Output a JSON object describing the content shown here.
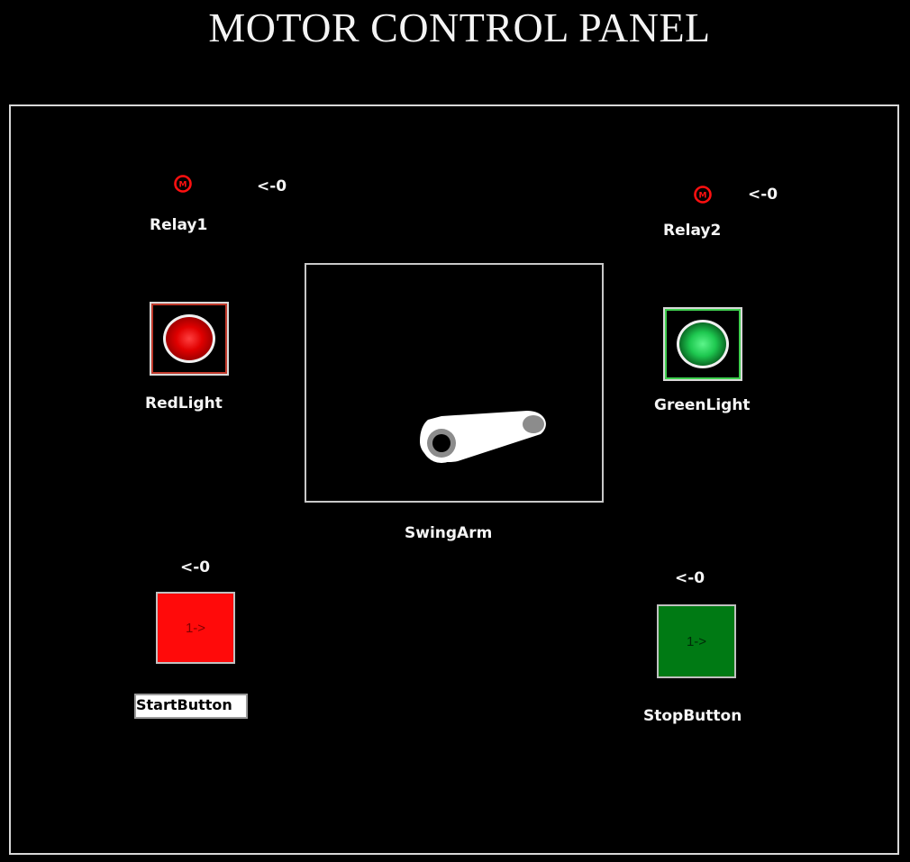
{
  "title": "MOTOR CONTROL PANEL",
  "relays": [
    {
      "name": "Relay1",
      "value_text": "<-0",
      "icon": "motor-relay-icon",
      "icon_letter": "M",
      "color": "#ff0000"
    },
    {
      "name": "Relay2",
      "value_text": "<-0",
      "icon": "motor-relay-icon",
      "icon_letter": "M",
      "color": "#ff0000"
    }
  ],
  "lights": [
    {
      "name": "RedLight",
      "color": "#ff0000",
      "state": "on"
    },
    {
      "name": "GreenLight",
      "color": "#1ec850",
      "state": "on"
    }
  ],
  "swing_arm": {
    "name": "SwingArm"
  },
  "buttons": [
    {
      "name": "StartButton",
      "value_text": "<-0",
      "face_text": "1->",
      "color": "#ff0a0a"
    },
    {
      "name": "StopButton",
      "value_text": "<-0",
      "face_text": "1->",
      "color": "#007a14"
    }
  ],
  "colors": {
    "background": "#000000",
    "text": "#ffffff",
    "frame": "#d8d8d8"
  }
}
